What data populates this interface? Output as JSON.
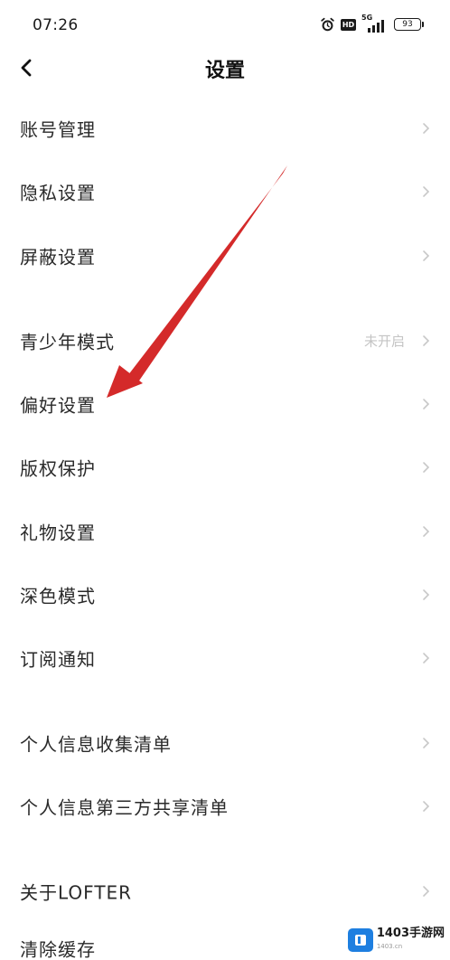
{
  "status_bar": {
    "time": "07:26",
    "network": "5G",
    "hd": "HD",
    "battery": "93"
  },
  "header": {
    "title": "设置"
  },
  "menu": {
    "items": [
      {
        "label": "账号管理"
      },
      {
        "label": "隐私设置"
      },
      {
        "label": "屏蔽设置"
      },
      {
        "label": "青少年模式",
        "status": "未开启"
      },
      {
        "label": "偏好设置"
      },
      {
        "label": "版权保护"
      },
      {
        "label": "礼物设置"
      },
      {
        "label": "深色模式"
      },
      {
        "label": "订阅通知"
      },
      {
        "label": "个人信息收集清单"
      },
      {
        "label": "个人信息第三方共享清单"
      },
      {
        "label": "关于LOFTER"
      },
      {
        "label": "清除缓存"
      }
    ]
  },
  "watermark": {
    "brand": "1403手游网",
    "sub": "1403.cn"
  },
  "colors": {
    "annotation_arrow": "#d42a2a",
    "chevron": "#c8c8c8",
    "watermark_blue": "#1e7fe0"
  }
}
